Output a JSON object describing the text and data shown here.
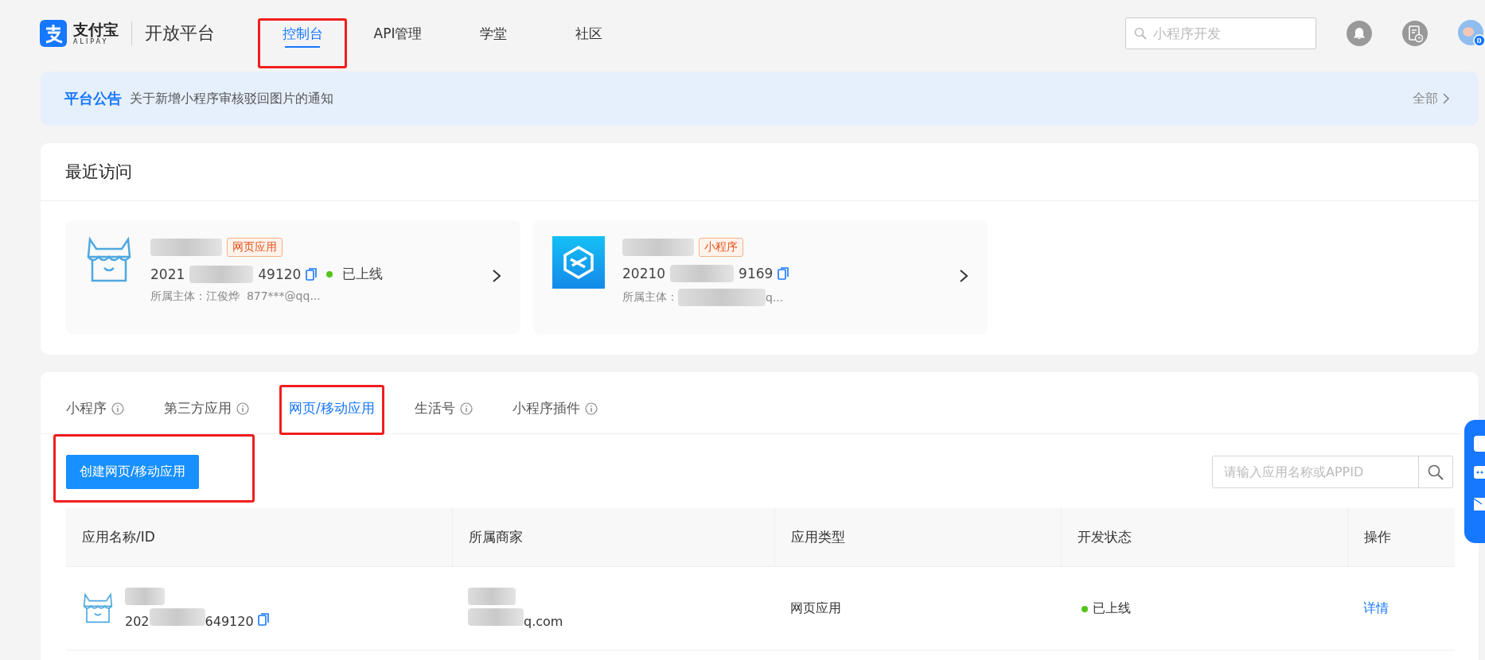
{
  "header": {
    "brand": "支付宝",
    "brand_sub": "ALIPAY",
    "platform": "开放平台",
    "nav": [
      {
        "label": "控制台",
        "selected": true
      },
      {
        "label": "API管理",
        "selected": false
      },
      {
        "label": "学堂",
        "selected": false
      },
      {
        "label": "社区",
        "selected": false
      }
    ],
    "search": {
      "placeholder": "小程序开发"
    }
  },
  "notice": {
    "label": "平台公告",
    "text": "关于新增小程序审核驳回图片的通知",
    "more": "全部"
  },
  "recent": {
    "title": "最近访问",
    "cards": [
      {
        "kind": "web",
        "tag": "网页应用",
        "id_start": "2021",
        "id_end": "49120",
        "status": "已上线",
        "owner_label": "所属主体：",
        "owner": "江俊烨  877***@qq..."
      },
      {
        "kind": "mini",
        "tag": "小程序",
        "id_start": "20210",
        "id_end": "9169",
        "owner_label": "所属主体：",
        "owner": "q..."
      }
    ]
  },
  "apps": {
    "tabs": [
      {
        "label": "小程序",
        "info": true,
        "selected": false
      },
      {
        "label": "第三方应用",
        "info": true,
        "selected": false
      },
      {
        "label": "网页/移动应用",
        "info": false,
        "selected": true
      },
      {
        "label": "生活号",
        "info": true,
        "selected": false
      },
      {
        "label": "小程序插件",
        "info": true,
        "selected": false
      }
    ],
    "create_button": "创建网页/移动应用",
    "search": {
      "placeholder": "请输入应用名称或APPID"
    },
    "table": {
      "columns": [
        "应用名称/ID",
        "所属商家",
        "应用类型",
        "开发状态",
        "操作"
      ],
      "rows": [
        {
          "id_start": "202",
          "id_end": "649120",
          "merchant": "q.com",
          "type": "网页应用",
          "status": "已上线",
          "action": "详情"
        }
      ]
    }
  }
}
